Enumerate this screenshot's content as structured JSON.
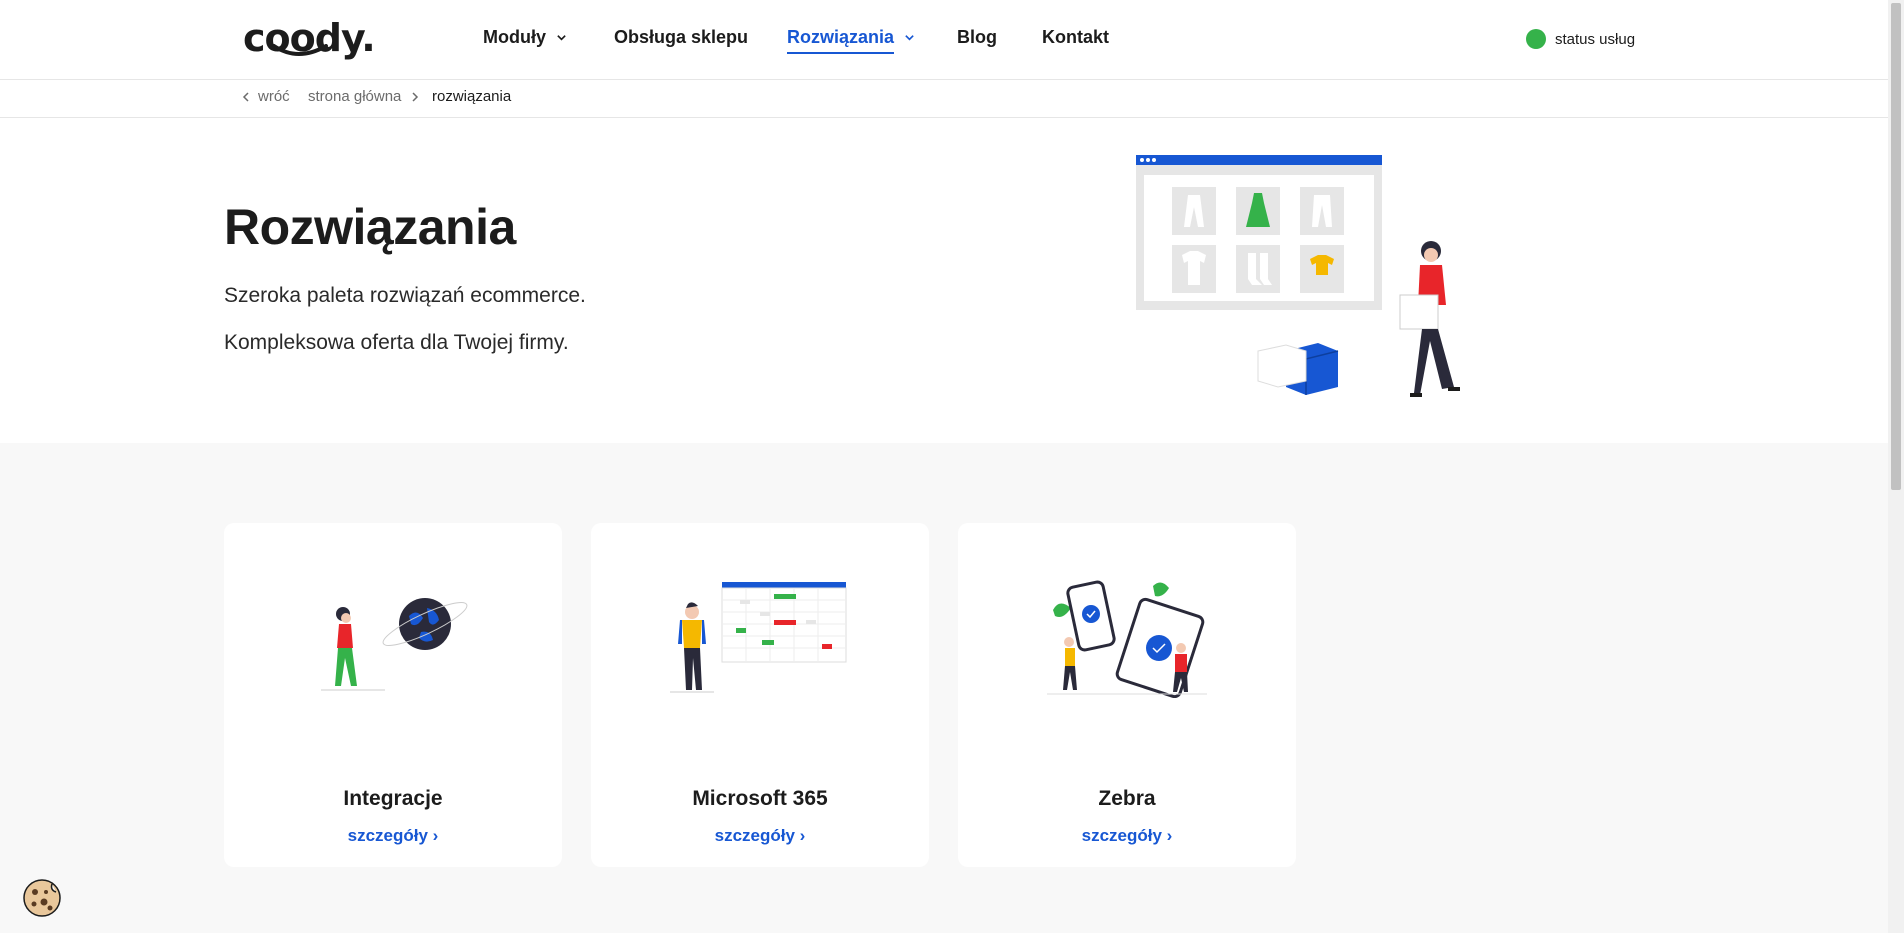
{
  "header": {
    "logo": "coody.",
    "nav": [
      {
        "label": "Moduły",
        "has_dropdown": true,
        "active": false
      },
      {
        "label": "Obsługa sklepu",
        "has_dropdown": false,
        "active": false
      },
      {
        "label": "Rozwiązania",
        "has_dropdown": true,
        "active": true
      },
      {
        "label": "Blog",
        "has_dropdown": false,
        "active": false
      },
      {
        "label": "Kontakt",
        "has_dropdown": false,
        "active": false
      }
    ],
    "status_label": "status usług",
    "status_color": "#35b24a"
  },
  "breadcrumb": {
    "back": "wróć",
    "home": "strona główna",
    "current": "rozwiązania"
  },
  "hero": {
    "title": "Rozwiązania",
    "line1": "Szeroka paleta rozwiązań ecommerce.",
    "line2": "Kompleksowa oferta dla Twojej firmy."
  },
  "cards": [
    {
      "title": "Integracje",
      "link": "szczegóły ›"
    },
    {
      "title": "Microsoft 365",
      "link": "szczegóły ›"
    },
    {
      "title": "Zebra",
      "link": "szczegóły ›"
    }
  ],
  "colors": {
    "accent": "#1757d3",
    "red": "#e8252a",
    "green": "#35b24a",
    "yellow": "#f5b800"
  },
  "icons": {
    "cookie": "cookie-icon",
    "dropdown": "chevron-down-icon",
    "back": "chevron-left-icon",
    "separator": "chevron-right-icon"
  }
}
